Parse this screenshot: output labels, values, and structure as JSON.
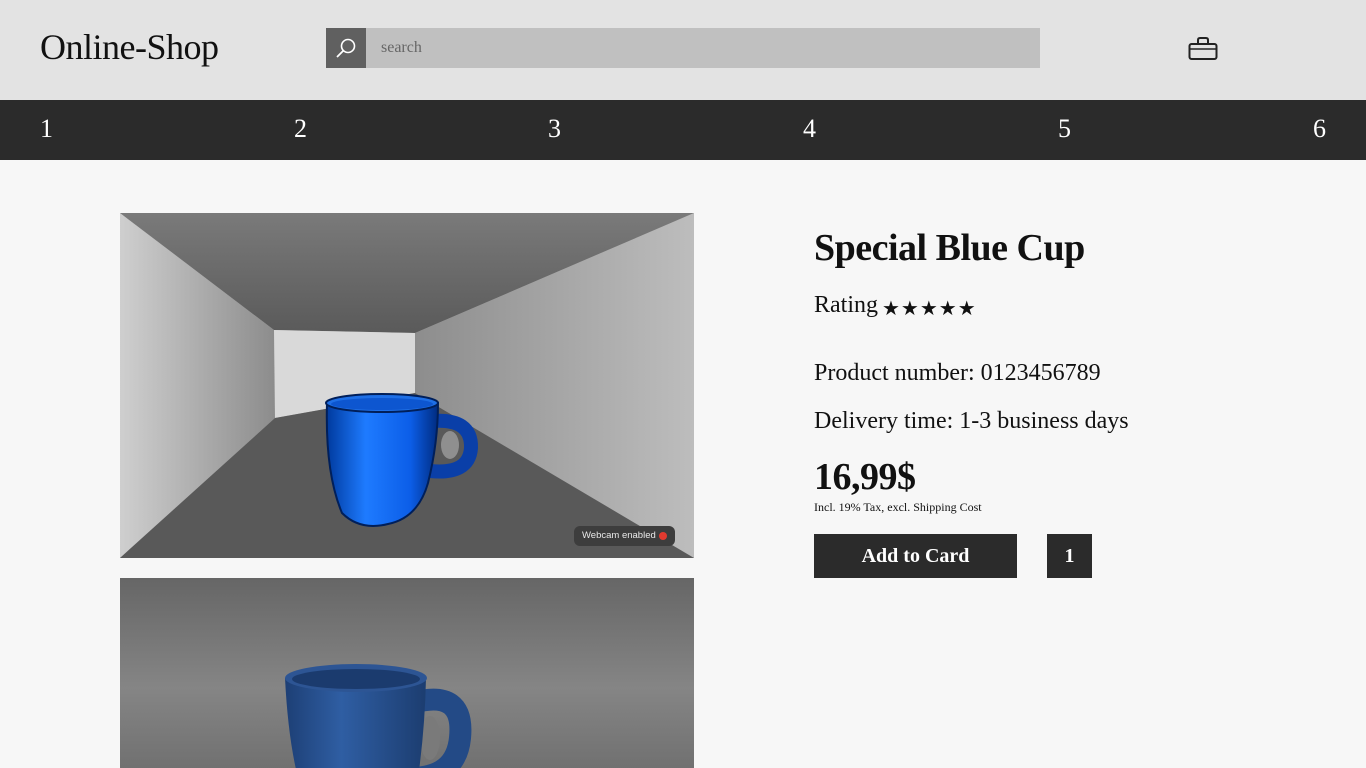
{
  "header": {
    "logo": "Online-Shop",
    "search_placeholder": "search",
    "search_icon": "search-icon",
    "cart_icon": "shopping-bag-icon"
  },
  "nav": {
    "items": [
      "1",
      "2",
      "3",
      "4",
      "5",
      "6"
    ]
  },
  "gallery": {
    "webcam_badge": "Webcam enabled",
    "webcam_status_color": "#e23a2f"
  },
  "product": {
    "title": "Special Blue Cup",
    "rating_label": "Rating",
    "rating_stars": "★★★★★",
    "rating_value": 5,
    "product_number": "Product number: 0123456789",
    "delivery_time": "Delivery time: 1-3 business days",
    "price": "16,99$",
    "tax_note": "Incl. 19% Tax, excl. Shipping Cost",
    "add_button": "Add to Card",
    "quantity": "1"
  },
  "colors": {
    "header_bg": "#e3e3e3",
    "nav_bg": "#2b2b2b",
    "page_bg": "#f7f7f7",
    "cup_blue": "#1565e6"
  }
}
